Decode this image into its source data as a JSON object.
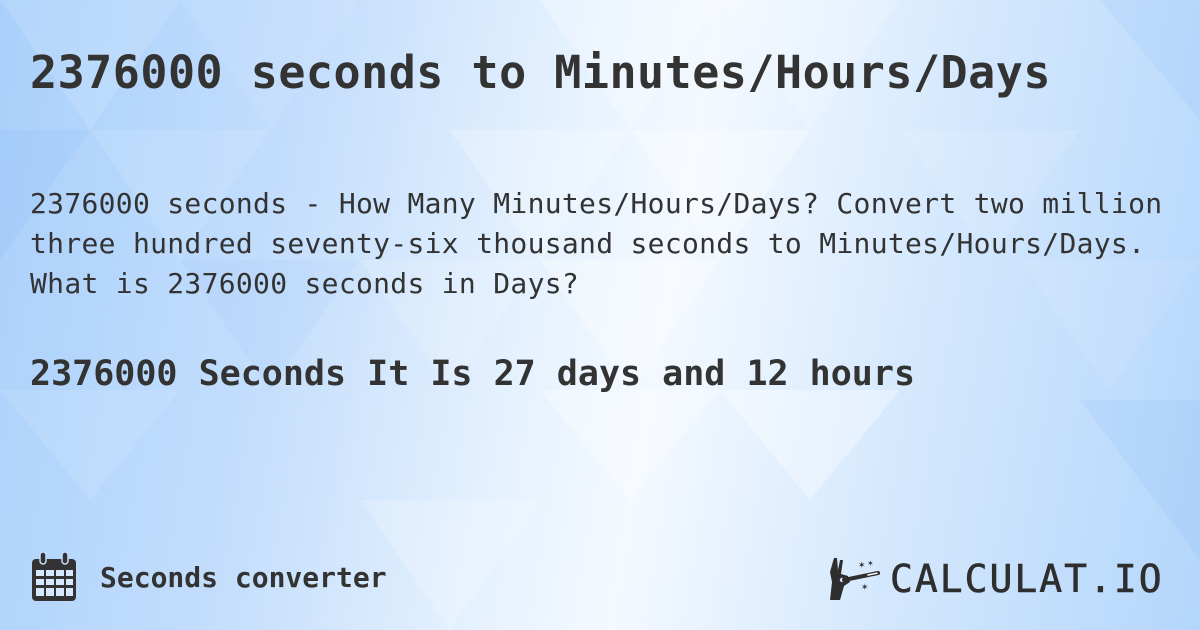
{
  "page": {
    "title": "2376000 seconds to Minutes/Hours/Days",
    "description": "2376000 seconds - How Many Minutes/Hours/Days? Convert two million three hundred seventy-six thousand seconds to Minutes/Hours/Days. What is 2376000 seconds in Days?",
    "answer": "2376000 Seconds It Is 27 days and 12 hours"
  },
  "footer": {
    "category_icon": "calendar-icon",
    "category_label": "Seconds converter",
    "logo_icon": "magic-wand-hand-icon",
    "logo_text": "CALCULAT.IO"
  },
  "colors": {
    "text": "#333333",
    "background_light": "#f4f9ff",
    "background_blue": "#a9d0fb"
  }
}
